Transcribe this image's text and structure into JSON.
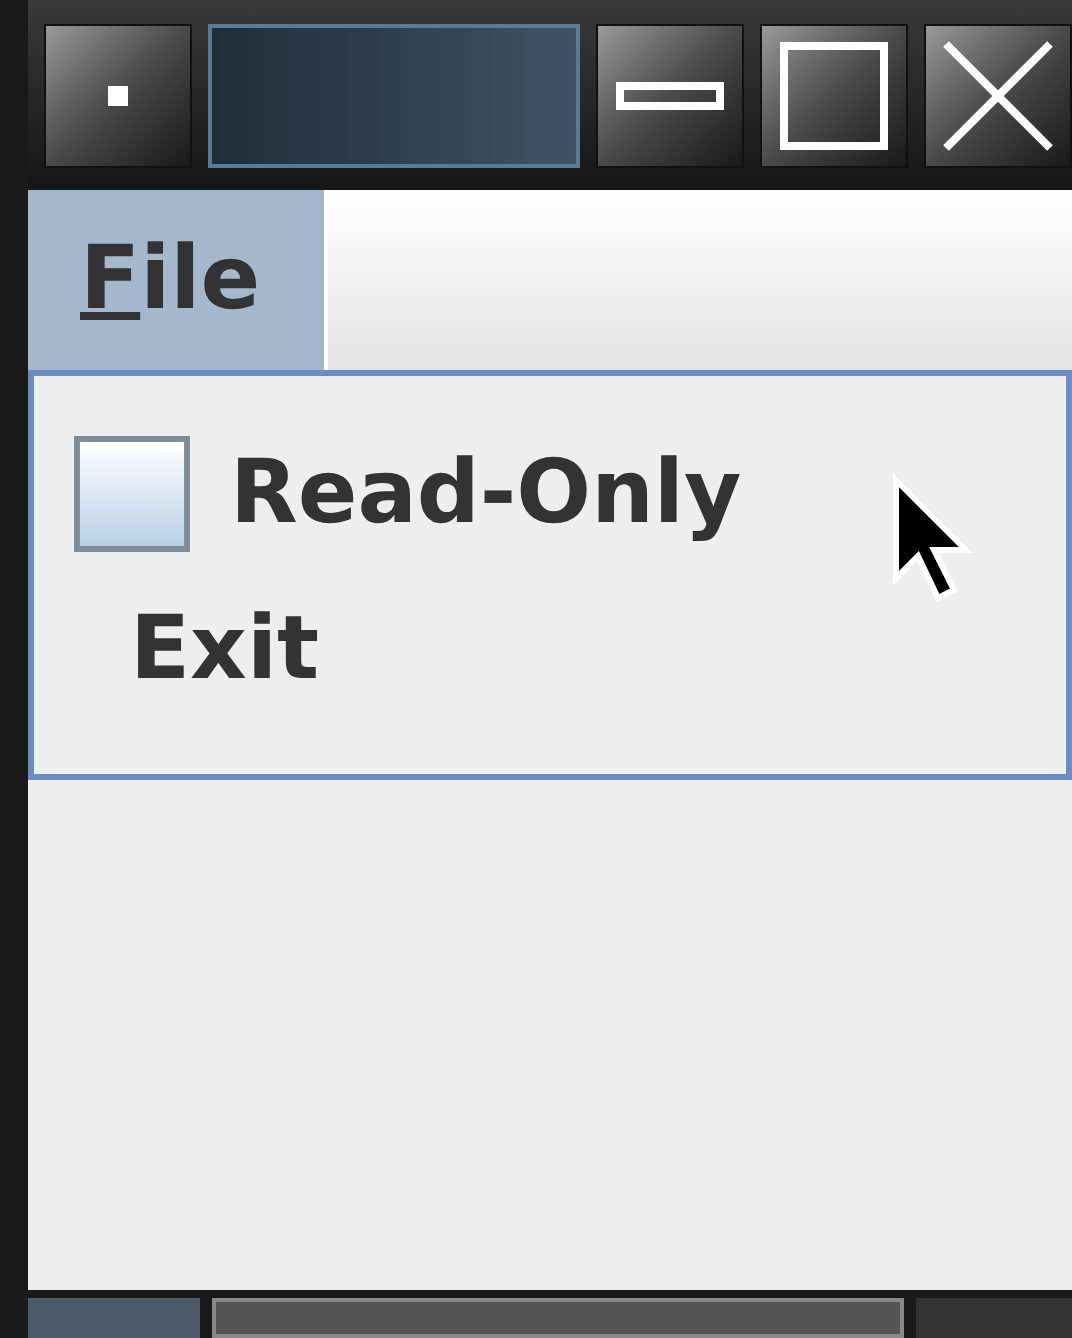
{
  "menu_bar": {
    "menus": [
      {
        "label": "File",
        "selected": true,
        "mnemonic_underlined": true
      }
    ]
  },
  "popup_menu": {
    "items": [
      {
        "kind": "checkbox",
        "label": "Read-Only",
        "checked": false
      },
      {
        "kind": "plain",
        "label": "Exit"
      }
    ]
  }
}
